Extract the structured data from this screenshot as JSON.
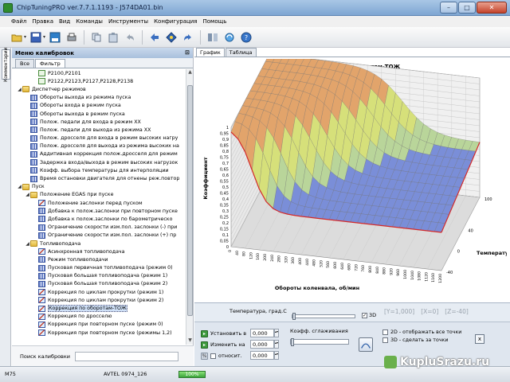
{
  "window": {
    "title": "ChipTuningPRO ver.7.7.1.1193 - J574DA01.bin",
    "minimize": "–",
    "maximize": "□",
    "close": "✕"
  },
  "menu": [
    "Файл",
    "Правка",
    "Вид",
    "Команды",
    "Инструменты",
    "Конфигурация",
    "Помощь"
  ],
  "toolbar": [
    "open-folder-icon",
    "save-icon",
    "save-as-icon",
    "print-icon",
    "copy-icon",
    "paste-icon",
    "undo-icon",
    "redo-icon",
    "navigate-icon",
    "target-icon",
    "compare-icon",
    "refresh-icon",
    "help-icon"
  ],
  "side_tab": "Комментарии",
  "panel": {
    "title": "Меню калибровок",
    "pin": "⊡",
    "tabs": [
      "Все",
      "Фильтр"
    ],
    "search_label": "Поиск калибровки",
    "tree": [
      {
        "level": 3,
        "expander": "",
        "icon": "check",
        "text": "P2100,P2101"
      },
      {
        "level": 3,
        "expander": "",
        "icon": "check",
        "text": "P2122,P2123,P2127,P2128,P2138"
      },
      {
        "level": 1,
        "expander": "◢",
        "icon": "folder",
        "text": "Диспетчер режимов"
      },
      {
        "level": 2,
        "expander": "",
        "icon": "grid",
        "text": "Обороты выхода из режима пуска"
      },
      {
        "level": 2,
        "expander": "",
        "icon": "grid",
        "text": "Обороты входа в режим пуска"
      },
      {
        "level": 2,
        "expander": "",
        "icon": "grid",
        "text": "Обороты выхода в режим пуска"
      },
      {
        "level": 2,
        "expander": "",
        "icon": "grid",
        "text": "Полож. педали для входа в режим XX"
      },
      {
        "level": 2,
        "expander": "",
        "icon": "grid",
        "text": "Полож. педали для выхода из режима XX"
      },
      {
        "level": 2,
        "expander": "",
        "icon": "grid",
        "text": "Полож. дросселя для входа в режим высоких нагру"
      },
      {
        "level": 2,
        "expander": "",
        "icon": "grid",
        "text": "Полож. дросселя для выхода из режима высоких на"
      },
      {
        "level": 2,
        "expander": "",
        "icon": "grid",
        "text": "Аддитивная коррекция полож.дросселя для режим"
      },
      {
        "level": 2,
        "expander": "",
        "icon": "grid",
        "text": "Задержка входа/выхода в режим высоких нагрузок"
      },
      {
        "level": 2,
        "expander": "",
        "icon": "grid",
        "text": "Коэфф. выбора температуры для интерполяции"
      },
      {
        "level": 2,
        "expander": "",
        "icon": "grid",
        "text": "Время остановки двигателя для отнены реж.повтор"
      },
      {
        "level": 1,
        "expander": "◢",
        "icon": "folder",
        "text": "Пуск"
      },
      {
        "level": 2,
        "expander": "◢",
        "icon": "folder",
        "text": "Положение EGAS при пуске"
      },
      {
        "level": 3,
        "expander": "",
        "icon": "chart",
        "text": "Положение заслонки перед пуском"
      },
      {
        "level": 3,
        "expander": "",
        "icon": "grid",
        "text": "Добавка к полож.заслонки при повторном пуске"
      },
      {
        "level": 3,
        "expander": "",
        "icon": "grid",
        "text": "Добавка к полож.заслонки по барометрическо"
      },
      {
        "level": 3,
        "expander": "",
        "icon": "grid",
        "text": "Ограничение скорости изм.пол. заслонки (-) при"
      },
      {
        "level": 3,
        "expander": "",
        "icon": "grid",
        "text": "Ограничение скорости изм.пол. заслонки (+) пр"
      },
      {
        "level": 2,
        "expander": "◢",
        "icon": "folder",
        "text": "Топливоподача"
      },
      {
        "level": 3,
        "expander": "",
        "icon": "chart",
        "text": "Асинхронная топливоподача"
      },
      {
        "level": 3,
        "expander": "",
        "icon": "grid",
        "text": "Режим топливоподачи"
      },
      {
        "level": 3,
        "expander": "",
        "icon": "grid",
        "text": "Пусковая первичная топливоподача (режим 0)"
      },
      {
        "level": 3,
        "expander": "",
        "icon": "grid",
        "text": "Пусковая большая топливоподача (режим 1)"
      },
      {
        "level": 3,
        "expander": "",
        "icon": "grid",
        "text": "Пусковая большая топливоподача (режим 2)"
      },
      {
        "level": 3,
        "expander": "",
        "icon": "chart",
        "text": "Коррекция по циклам прокрутки (режим 1)"
      },
      {
        "level": 3,
        "expander": "",
        "icon": "chart",
        "text": "Коррекция по циклам прокрутки (режим 2)"
      },
      {
        "level": 3,
        "expander": "",
        "icon": "chart",
        "text": "Коррекция по оборотам-ТОЖ",
        "selected": true
      },
      {
        "level": 3,
        "expander": "",
        "icon": "chart",
        "text": "Коррекция по дросселю"
      },
      {
        "level": 3,
        "expander": "",
        "icon": "chart",
        "text": "Коррекция при повторном пуске (режим 0)"
      },
      {
        "level": 3,
        "expander": "",
        "icon": "chart",
        "text": "Коррекция при повторном пуске (режимы 1,2)"
      }
    ]
  },
  "right": {
    "tabs": [
      "График",
      "Таблица"
    ]
  },
  "chart_data": {
    "type": "surface3d",
    "title": "Коррекция по оборотам-ТОЖ",
    "xlabel": "Обороты коленвала, об/мин",
    "ylabel": "Температура",
    "zlabel": "Коэффициент",
    "x": [
      0,
      40,
      80,
      120,
      160,
      200,
      240,
      280,
      320,
      360,
      400,
      440,
      480,
      520,
      560,
      600,
      640,
      680,
      720,
      760,
      800,
      840,
      880,
      920,
      960,
      1000,
      1040,
      1080,
      1120,
      1160,
      1200
    ],
    "y_ticks": [
      -40,
      0,
      40,
      100
    ],
    "z_ticks": [
      "0",
      "0,05",
      "0,1",
      "0,15",
      "0,2",
      "0,25",
      "0,3",
      "0,35",
      "0,4",
      "0,45",
      "0,5",
      "0,55",
      "0,6",
      "0,65",
      "0,7",
      "0,75",
      "0,8",
      "0,85",
      "0,9",
      "0,95",
      "1"
    ],
    "zlim": [
      0,
      1
    ],
    "colors": {
      "low": "#7a8ed8",
      "mid": "#d6e07a",
      "high": "#e2a46b",
      "edge": "#d42a2a"
    }
  },
  "controls": {
    "temp_label": "Температура, град.С",
    "chk_3d": "3D",
    "readout": {
      "y": "[Y=1,000]",
      "x": "[X=0]",
      "z": "[Z=-40]"
    },
    "set_label": "Установить в",
    "change_label": "Изменить на",
    "relative_label": "относит.",
    "set_value": "0,000",
    "change_value": "0,000",
    "relative_value": "0,000",
    "smooth_label": "Коэфф. сглаживания",
    "opt_2d": "2D - отображать все точки",
    "opt_3d": "3D - сделать за точки",
    "close_btn": "x"
  },
  "status": {
    "left": "M75",
    "ecu": "AVTEL 0974_126",
    "progress": "100%"
  },
  "watermark": {
    "text": "KupluSrazu.ru"
  }
}
